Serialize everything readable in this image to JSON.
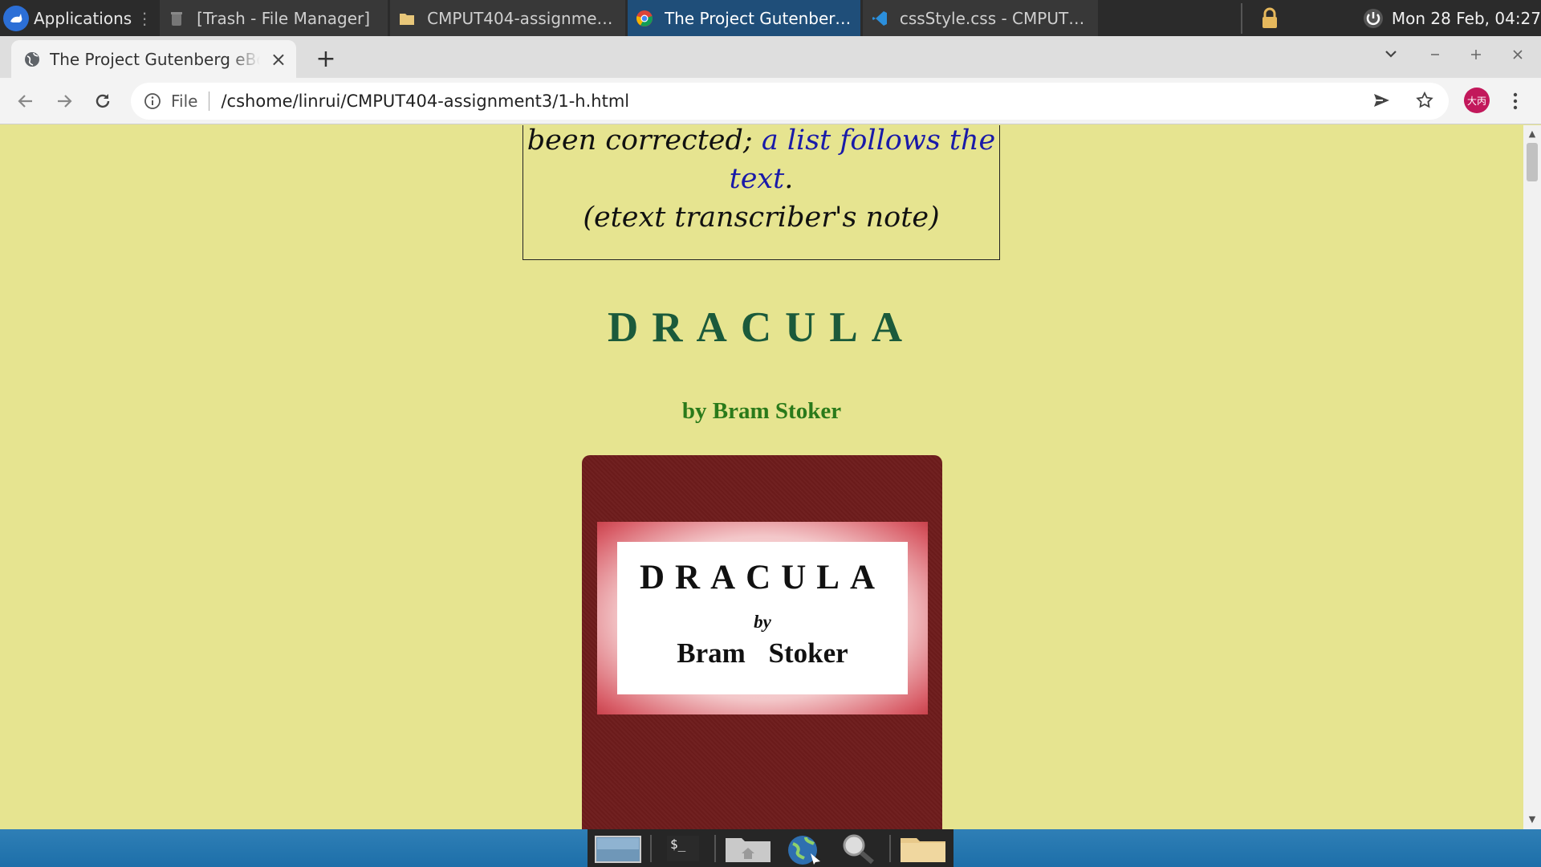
{
  "panel": {
    "applications_label": "Applications",
    "tasks": [
      {
        "label": "[Trash - File Manager]",
        "icon": "trash-icon",
        "active": false
      },
      {
        "label": "CMPUT404-assignment...",
        "icon": "folder-icon",
        "active": false
      },
      {
        "label": "The Project Gutenberg ...",
        "icon": "chrome-icon",
        "active": true
      },
      {
        "label": "cssStyle.css - CMPUT4...",
        "icon": "vscode-icon",
        "active": false
      }
    ],
    "clock": "Mon 28 Feb, 04:27"
  },
  "browser": {
    "tab_title": "The Project Gutenberg eBook of Dracula",
    "tab_close": "×",
    "new_tab": "+",
    "file_label": "File",
    "url": "/cshome/linrui/CMPUT404-assignment3/1-h.html",
    "avatar_text": "大丙"
  },
  "page": {
    "note_line1": "been corrected;",
    "note_link": "a list follows the text",
    "note_period": ".",
    "note_line3": "(etext transcriber's note)",
    "title": "DRACULA",
    "byline": "by Bram Stoker",
    "cover": {
      "title": "DRACULA",
      "by": "by",
      "author": "Bram Stoker"
    }
  },
  "colors": {
    "page_background": "#e6e490",
    "title_color": "#1b5a3b",
    "byline_color": "#2a7a1a",
    "link_color": "#1a1aa8",
    "cover_cloth": "#6e1c1c"
  }
}
